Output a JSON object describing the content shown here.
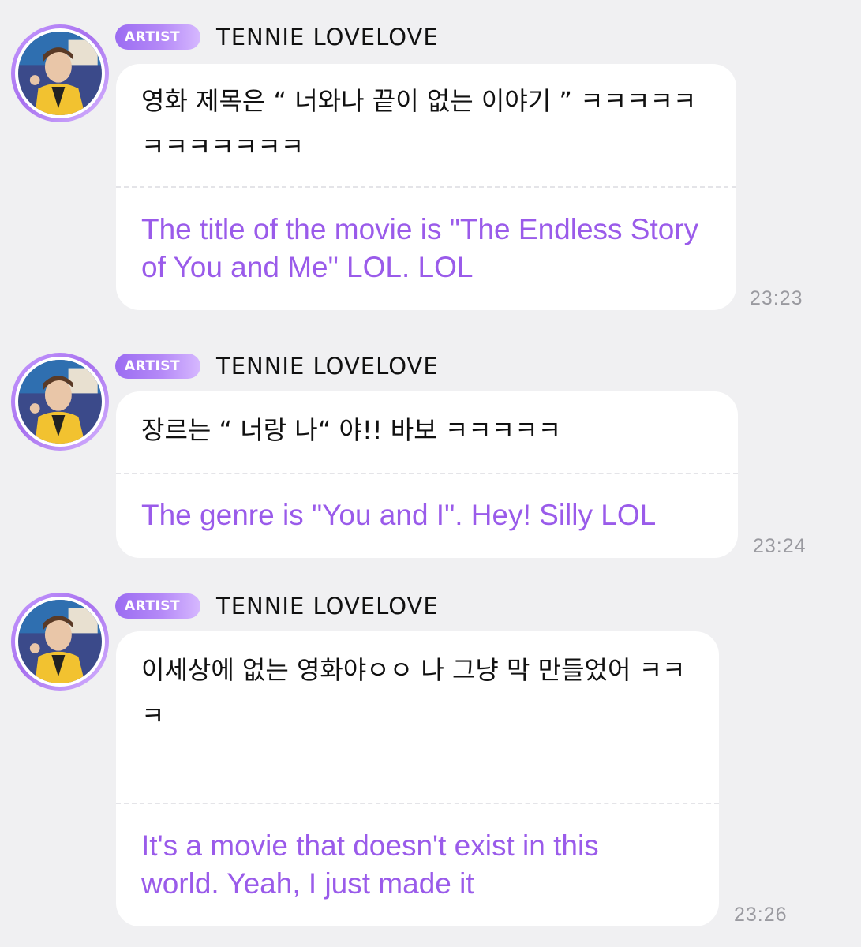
{
  "messages": [
    {
      "badge": "ARTIST",
      "name": "TENNIE LOVELOVE",
      "korean": "영화 제목은 “ 너와나 끝이 없는 이야기 ” ㅋㅋㅋㅋㅋㅋㅋㅋㅋㅋㅋㅋ",
      "english": "The title of the movie is \"The Endless Story of You and Me\" LOL. LOL",
      "time": "23:23"
    },
    {
      "badge": "ARTIST",
      "name": "TENNIE LOVELOVE",
      "korean": "장르는 “ 너랑 나“ 야!! 바보 ㅋㅋㅋㅋㅋ",
      "english": "The genre is \"You and I\". Hey! Silly LOL",
      "time": "23:24"
    },
    {
      "badge": "ARTIST",
      "name": "TENNIE LOVELOVE",
      "korean": "이세상에 없는 영화야ㅇㅇ 나 그냥 막 만들었어 ㅋㅋㅋ",
      "english": "It's a movie that doesn't exist in this world. Yeah, I just made it",
      "time": "23:26"
    }
  ],
  "colors": {
    "background": "#f0f0f2",
    "translation": "#9a5bea",
    "badge": "#9b6cf2",
    "timestamp": "#9a9aa0"
  }
}
